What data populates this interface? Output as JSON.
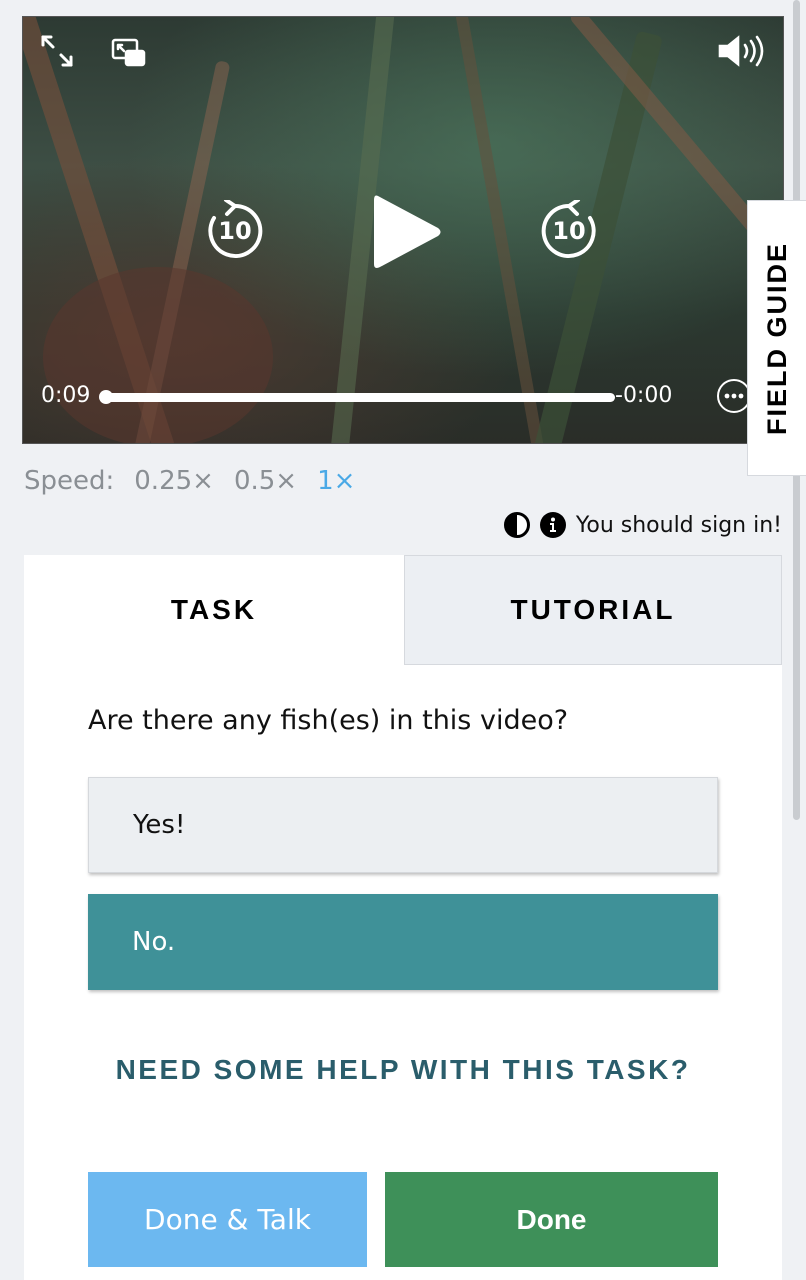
{
  "video": {
    "current_time": "0:09",
    "remaining_time": "-0:00",
    "progress": 1.0,
    "rewind_seconds": "10",
    "forward_seconds": "10"
  },
  "field_guide": {
    "label": "FIELD GUIDE"
  },
  "speed": {
    "label": "Speed:",
    "options": [
      "0.25×",
      "0.5×",
      "1×"
    ],
    "active": "1×",
    "active_color": "#4aa9e6"
  },
  "signin": {
    "message": "You should sign in!"
  },
  "tabs": [
    {
      "label": "TASK",
      "active": true
    },
    {
      "label": "TUTORIAL",
      "active": false
    }
  ],
  "task": {
    "question": "Are there any fish(es) in this video?",
    "answers": [
      {
        "label": "Yes!",
        "selected": false
      },
      {
        "label": "No.",
        "selected": true,
        "color": "#3f9198"
      }
    ],
    "help_text": "NEED SOME HELP WITH THIS TASK?"
  },
  "buttons": {
    "done_talk": "Done & Talk",
    "done": "Done",
    "done_talk_color": "#6cb8f0",
    "done_color": "#3e9059"
  },
  "icons": [
    "expand-icon",
    "picture-in-picture-icon",
    "volume-icon",
    "rewind-10-icon",
    "play-icon",
    "forward-10-icon",
    "more-options-icon",
    "contrast-icon",
    "info-icon"
  ]
}
